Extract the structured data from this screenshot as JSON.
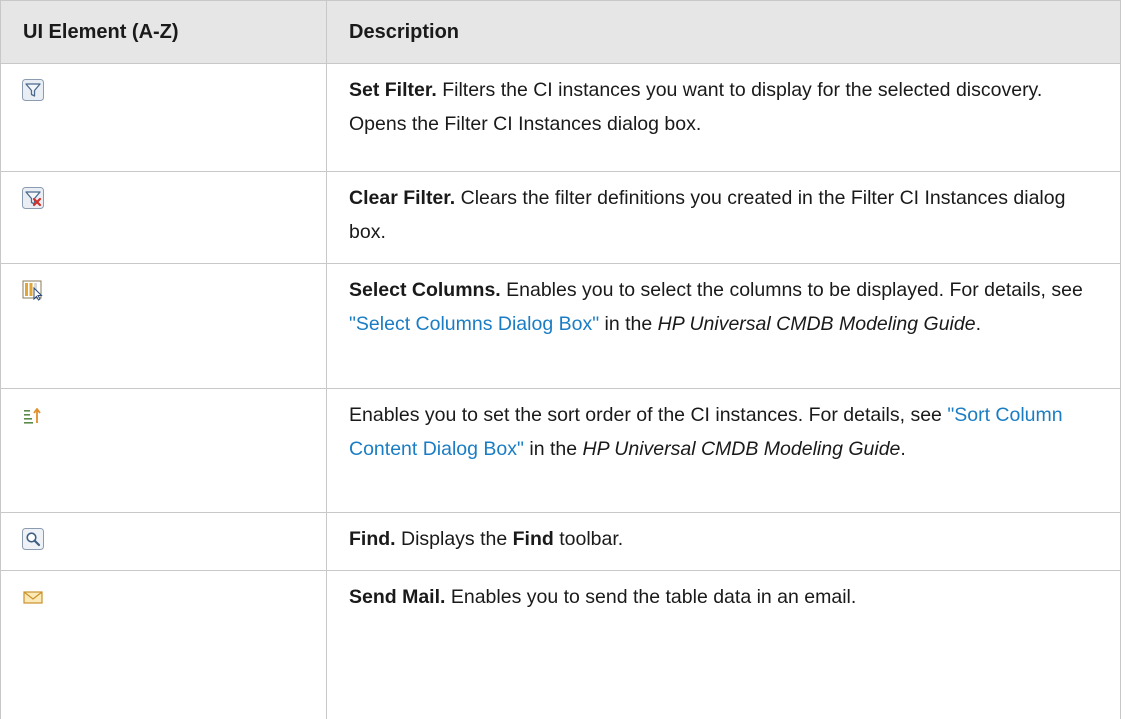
{
  "header": {
    "col1": "UI Element (A-Z)",
    "col2": "Description"
  },
  "rows": [
    {
      "icon": "filter-icon",
      "title": "Set Filter.",
      "text": " Filters the CI instances you want to display for the selected discovery. Opens the Filter CI Instances dialog box."
    },
    {
      "icon": "clear-filter-icon",
      "title": "Clear Filter.",
      "text": " Clears the filter definitions you created in the Filter CI Instances dialog box."
    },
    {
      "icon": "select-columns-icon",
      "title": "Select Columns.",
      "text": " Enables you to select the columns to be displayed. For details, see ",
      "link": "\"Select Columns Dialog Box\"",
      "text2": " in the ",
      "guide": "HP Universal CMDB Modeling Guide",
      "end": "."
    },
    {
      "icon": "sort-order-icon",
      "text": "Enables you to set the sort order of the CI instances. For details, see ",
      "link": "\"Sort Column Content Dialog Box\"",
      "text2": " in the ",
      "guide": "HP Universal CMDB Modeling Guide",
      "end": "."
    },
    {
      "icon": "search-icon",
      "title": "Find.",
      "text": " Displays the ",
      "bold2": "Find",
      "text2": " toolbar."
    },
    {
      "icon": "mail-icon",
      "title": "Send Mail.",
      "text": " Enables you to send the table data in an email."
    }
  ],
  "colors": {
    "header_bg": "#e6e6e6",
    "border": "#c8c8c8",
    "link": "#1a7dc4"
  }
}
